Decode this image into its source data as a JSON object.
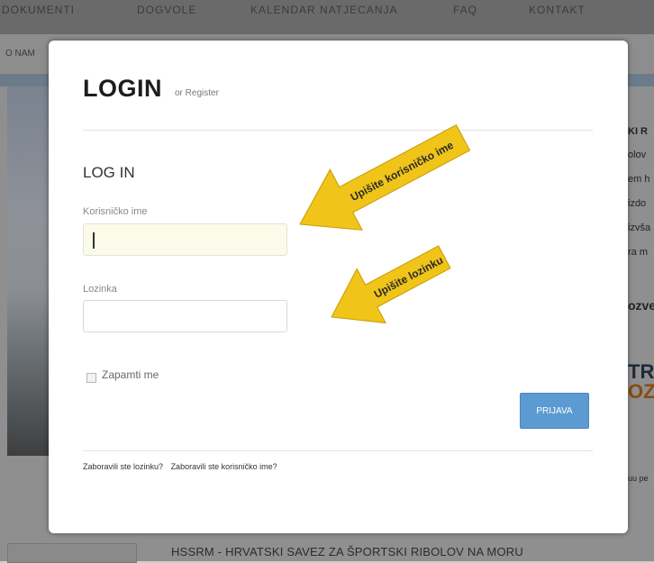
{
  "background": {
    "nav_items": [
      "DOKUMENTI",
      "DOGVOLE",
      "KALENDAR NATJECANJA",
      "FAQ",
      "KONTAKT"
    ],
    "subnav_item": "O NAM",
    "right_col_texts": [
      "KI R",
      "olov",
      "em h",
      "izdo",
      "izvša",
      "ra m",
      "ozve",
      "TR",
      "OZ",
      "uu pe"
    ],
    "footer_text": "HSSRM - HRVATSKI SAVEZ ZA ŠPORTSKI RIBOLOV NA MORU"
  },
  "modal": {
    "title": "LOGIN",
    "register_text": "or Register",
    "subtitle": "LOG IN",
    "username_label": "Korisničko ime",
    "username_value": "",
    "password_label": "Lozinka",
    "password_value": "",
    "remember_label": "Zapamti me",
    "submit_label": "PRIJAVA",
    "forgot_password": "Zaboravili ste lozinku?",
    "forgot_username": "Zaboravili ste korisničko ime?"
  },
  "annotations": {
    "username_arrow": "Upišite korisničko ime",
    "password_arrow": "Upišite lozinku"
  },
  "colors": {
    "arrow_fill": "#f0c419",
    "button": "#5b9bd1",
    "active_input": "#fbfbe9"
  }
}
